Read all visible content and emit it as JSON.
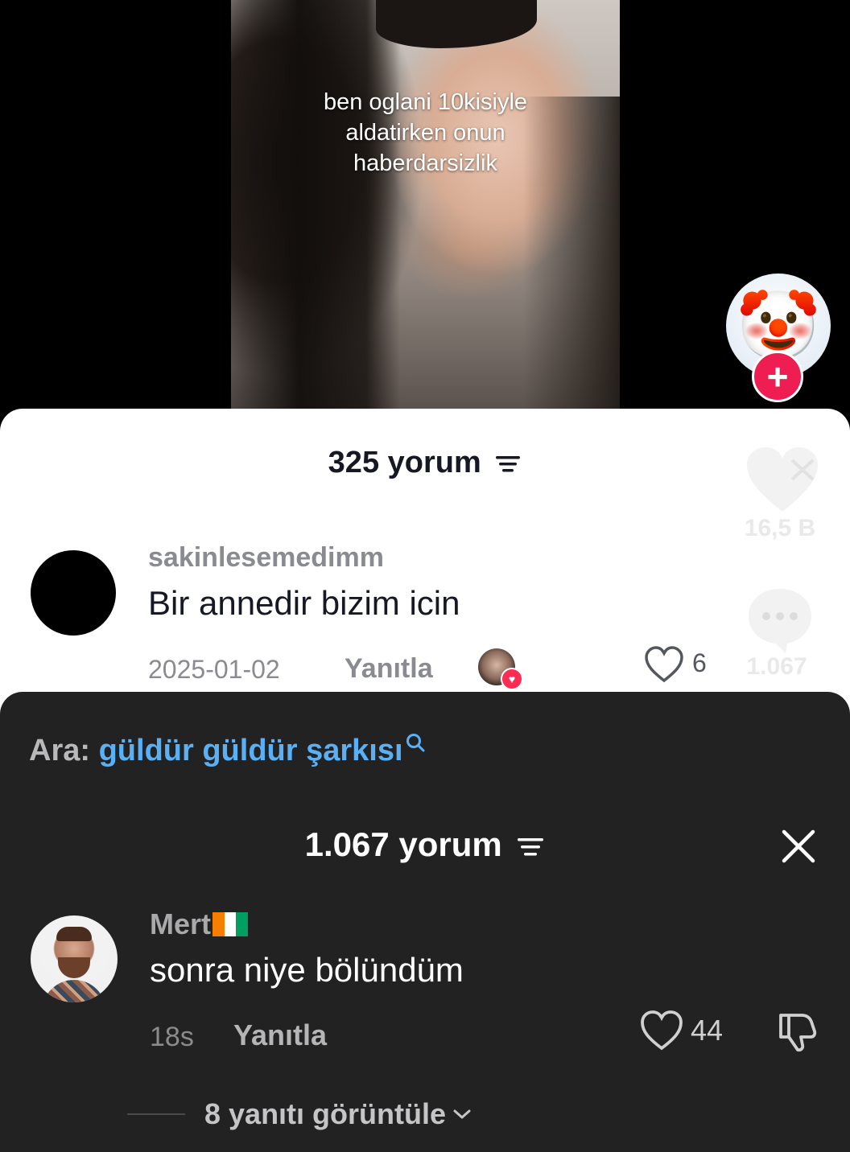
{
  "video": {
    "caption_line1": "ben oglani 10kisiyle",
    "caption_line2": "aldatirken onun",
    "caption_line3": "haberdarsizlik",
    "profile_emoji": "🤡",
    "follow_symbol": "+"
  },
  "white_sheet": {
    "comment_count": "325 yorum",
    "side_likes": "16,5 B",
    "side_comments": "1.067",
    "comment": {
      "username": "sakinlesemedimm",
      "text": "Bir annedir bizim icin",
      "date": "2025-01-02",
      "reply_label": "Yanıtla",
      "likes": "6"
    }
  },
  "dark_sheet": {
    "search_prefix": "Ara:",
    "search_term": "güldür güldür şarkısı",
    "comment_count": "1.067 yorum",
    "comment": {
      "username": "Mert",
      "text": "sonra niye bölündüm",
      "time": "18s",
      "reply_label": "Yanıtla",
      "likes": "44"
    },
    "view_replies": "8 yanıtı görüntüle"
  },
  "colors": {
    "accent_red": "#fe2c55",
    "search_blue": "#5ab0f5",
    "dark_bg": "#222222"
  },
  "icons": [
    "filter-icon",
    "heart-icon",
    "comment-icon",
    "dislike-icon",
    "search-icon",
    "close-icon",
    "chevron-down-icon",
    "ivory-coast-flag-icon"
  ]
}
